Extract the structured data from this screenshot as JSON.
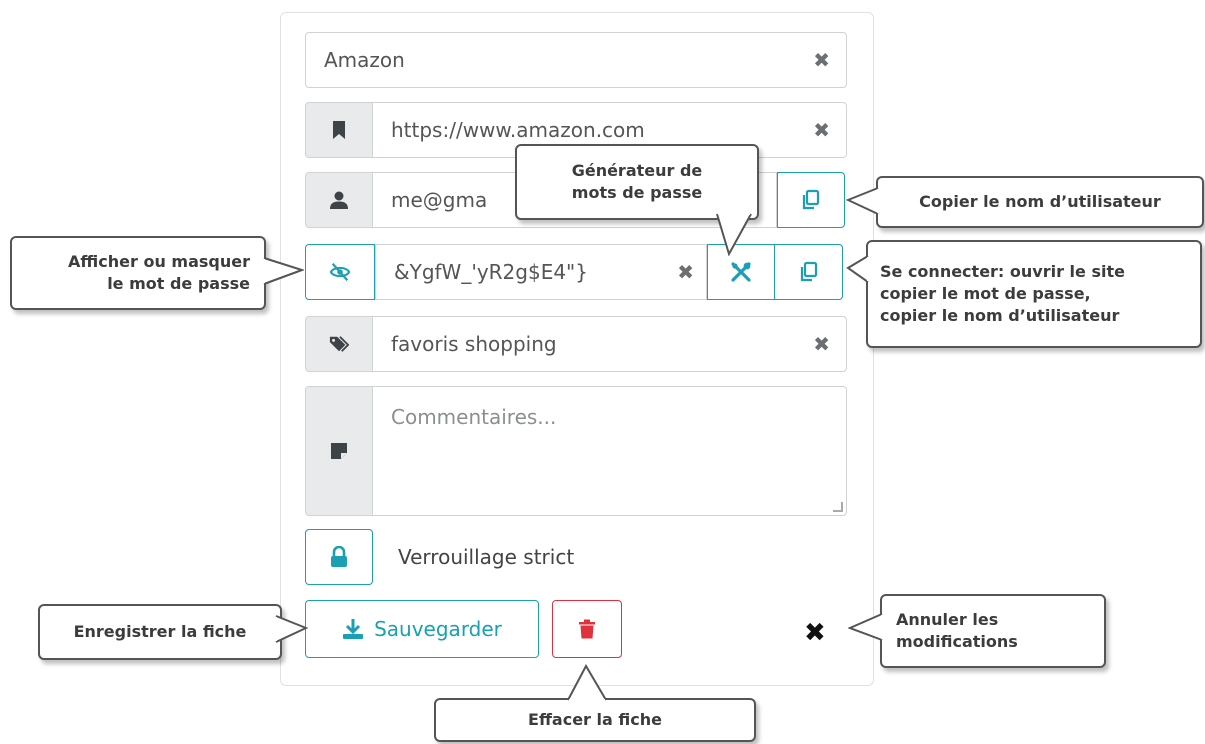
{
  "entry": {
    "title_value": "Amazon",
    "url_value": "https://www.amazon.com",
    "username_value": "me@gma",
    "password_value": "&YgfW_'yR2g$E4\"}",
    "tags_value": "favoris shopping",
    "comments_placeholder": "Commentaires...",
    "clear_symbol": "✖"
  },
  "lock": {
    "label": "Verrouillage strict"
  },
  "actions": {
    "save_label": "Sauvegarder",
    "cancel_symbol": "✖"
  },
  "callouts": {
    "generator": [
      "Générateur de",
      "mots de passe"
    ],
    "copy_username": "Copier le nom d’utilisateur",
    "toggle_password": [
      "Afficher ou masquer",
      "le mot de passe"
    ],
    "connect": [
      "Se connecter: ouvrir le site",
      "copier le mot de passe,",
      "copier le nom d’utilisateur"
    ],
    "save": "Enregistrer la fiche",
    "cancel": [
      "Annuler les",
      "modifications"
    ],
    "delete": "Effacer la fiche"
  },
  "colors": {
    "accent": "#1a9fb4",
    "danger": "#e0323c",
    "addon_bg": "#e8eaeb"
  },
  "icons": [
    "bookmark-icon",
    "user-icon",
    "eye-slash-icon",
    "tags-icon",
    "sticky-note-icon",
    "wrench-screwdriver-icon",
    "copy-icon",
    "lock-icon",
    "download-icon",
    "trash-icon",
    "close-icon"
  ]
}
